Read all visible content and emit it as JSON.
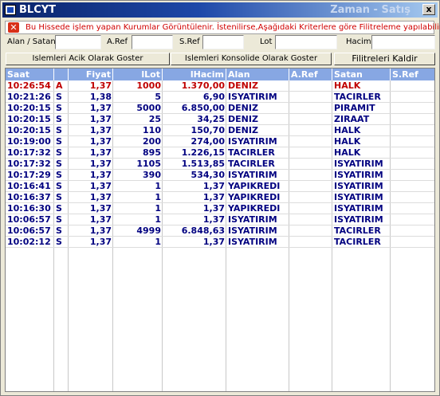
{
  "window": {
    "title": "BLCYT",
    "title_right": "Zaman - Satış",
    "close_label": "x"
  },
  "info": {
    "text": "Bu Hissede işlem yapan Kurumlar Görüntülenir. İstenilirse,Aşağıdaki Kriterlere göre Filitreleme yapılabilir."
  },
  "filters": {
    "alan_satan_label": "Alan / Satan",
    "aref_label": "A.Ref",
    "sref_label": "S.Ref",
    "lot_label": "Lot",
    "hacim_label": "Hacim",
    "alan_satan_value": "",
    "aref_value": "",
    "sref_value": "",
    "lot_value": "",
    "hacim_value": ""
  },
  "buttons": {
    "acik": "Islemleri Acik Olarak Goster",
    "konsolide": "Islemleri Konsolide Olarak Goster",
    "kaldir": "Filitreleri Kaldir"
  },
  "columns": [
    "Saat",
    "",
    "Fiyat",
    "lLot",
    "lHacim",
    "Alan",
    "A.Ref",
    "Satan",
    "S.Ref"
  ],
  "rows": [
    {
      "saat": "10:26:54",
      "side": "A",
      "fiyat": "1,37",
      "lot": "1000",
      "hacim": "1.370,00",
      "alan": "DENIZ",
      "aref": "",
      "satan": "HALK",
      "sref": "",
      "color": "red"
    },
    {
      "saat": "10:21:26",
      "side": "S",
      "fiyat": "1,38",
      "lot": "5",
      "hacim": "6,90",
      "alan": "ISYATIRIM",
      "aref": "",
      "satan": "TACIRLER",
      "sref": "",
      "color": "blue"
    },
    {
      "saat": "10:20:15",
      "side": "S",
      "fiyat": "1,37",
      "lot": "5000",
      "hacim": "6.850,00",
      "alan": "DENIZ",
      "aref": "",
      "satan": "PIRAMIT",
      "sref": "",
      "color": "blue"
    },
    {
      "saat": "10:20:15",
      "side": "S",
      "fiyat": "1,37",
      "lot": "25",
      "hacim": "34,25",
      "alan": "DENIZ",
      "aref": "",
      "satan": "ZIRAAT",
      "sref": "",
      "color": "blue"
    },
    {
      "saat": "10:20:15",
      "side": "S",
      "fiyat": "1,37",
      "lot": "110",
      "hacim": "150,70",
      "alan": "DENIZ",
      "aref": "",
      "satan": "HALK",
      "sref": "",
      "color": "blue"
    },
    {
      "saat": "10:19:00",
      "side": "S",
      "fiyat": "1,37",
      "lot": "200",
      "hacim": "274,00",
      "alan": "ISYATIRIM",
      "aref": "",
      "satan": "HALK",
      "sref": "",
      "color": "blue"
    },
    {
      "saat": "10:17:32",
      "side": "S",
      "fiyat": "1,37",
      "lot": "895",
      "hacim": "1.226,15",
      "alan": "TACIRLER",
      "aref": "",
      "satan": "HALK",
      "sref": "",
      "color": "blue"
    },
    {
      "saat": "10:17:32",
      "side": "S",
      "fiyat": "1,37",
      "lot": "1105",
      "hacim": "1.513,85",
      "alan": "TACIRLER",
      "aref": "",
      "satan": "ISYATIRIM",
      "sref": "",
      "color": "blue"
    },
    {
      "saat": "10:17:29",
      "side": "S",
      "fiyat": "1,37",
      "lot": "390",
      "hacim": "534,30",
      "alan": "ISYATIRIM",
      "aref": "",
      "satan": "ISYATIRIM",
      "sref": "",
      "color": "blue"
    },
    {
      "saat": "10:16:41",
      "side": "S",
      "fiyat": "1,37",
      "lot": "1",
      "hacim": "1,37",
      "alan": "YAPIKREDI",
      "aref": "",
      "satan": "ISYATIRIM",
      "sref": "",
      "color": "blue"
    },
    {
      "saat": "10:16:37",
      "side": "S",
      "fiyat": "1,37",
      "lot": "1",
      "hacim": "1,37",
      "alan": "YAPIKREDI",
      "aref": "",
      "satan": "ISYATIRIM",
      "sref": "",
      "color": "blue"
    },
    {
      "saat": "10:16:30",
      "side": "S",
      "fiyat": "1,37",
      "lot": "1",
      "hacim": "1,37",
      "alan": "YAPIKREDI",
      "aref": "",
      "satan": "ISYATIRIM",
      "sref": "",
      "color": "blue"
    },
    {
      "saat": "10:06:57",
      "side": "S",
      "fiyat": "1,37",
      "lot": "1",
      "hacim": "1,37",
      "alan": "ISYATIRIM",
      "aref": "",
      "satan": "ISYATIRIM",
      "sref": "",
      "color": "blue"
    },
    {
      "saat": "10:06:57",
      "side": "S",
      "fiyat": "1,37",
      "lot": "4999",
      "hacim": "6.848,63",
      "alan": "ISYATIRIM",
      "aref": "",
      "satan": "TACIRLER",
      "sref": "",
      "color": "blue"
    },
    {
      "saat": "10:02:12",
      "side": "S",
      "fiyat": "1,37",
      "lot": "1",
      "hacim": "1,37",
      "alan": "ISYATIRIM",
      "aref": "",
      "satan": "TACIRLER",
      "sref": "",
      "color": "blue"
    }
  ],
  "colors": {
    "header_bg": "#87a7e3",
    "buy": "#c00000",
    "sell": "#000080"
  }
}
